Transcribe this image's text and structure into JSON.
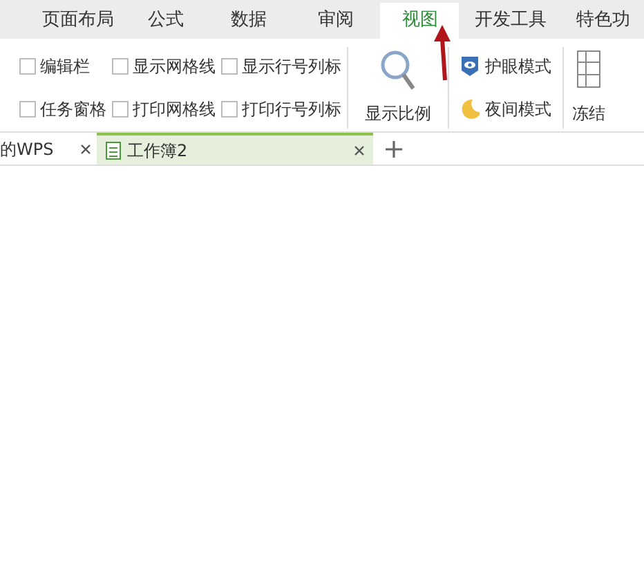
{
  "ribbon_tabs": [
    {
      "label": "页面布局",
      "selected": false
    },
    {
      "label": "公式",
      "selected": false
    },
    {
      "label": "数据",
      "selected": false
    },
    {
      "label": "审阅",
      "selected": false
    },
    {
      "label": "视图",
      "selected": true
    },
    {
      "label": "开发工具",
      "selected": false
    },
    {
      "label": "特色功",
      "selected": false
    }
  ],
  "checkbox_columns": [
    [
      {
        "label": "编辑栏",
        "checked": false
      },
      {
        "label": "任务窗格",
        "checked": false
      }
    ],
    [
      {
        "label": "显示网格线",
        "checked": false
      },
      {
        "label": "打印网格线",
        "checked": false
      }
    ],
    [
      {
        "label": "显示行号列标",
        "checked": false
      },
      {
        "label": "打印行号列标",
        "checked": false
      }
    ]
  ],
  "zoom_button": {
    "label": "显示比例"
  },
  "mode_buttons": [
    {
      "label": "护眼模式",
      "kind": "eye"
    },
    {
      "label": "夜间模式",
      "kind": "moon"
    }
  ],
  "freeze_button": {
    "label": "冻结"
  },
  "doc_tabs": [
    {
      "label": "的WPS",
      "selected": false
    },
    {
      "label": "工作簿2",
      "selected": true
    }
  ]
}
